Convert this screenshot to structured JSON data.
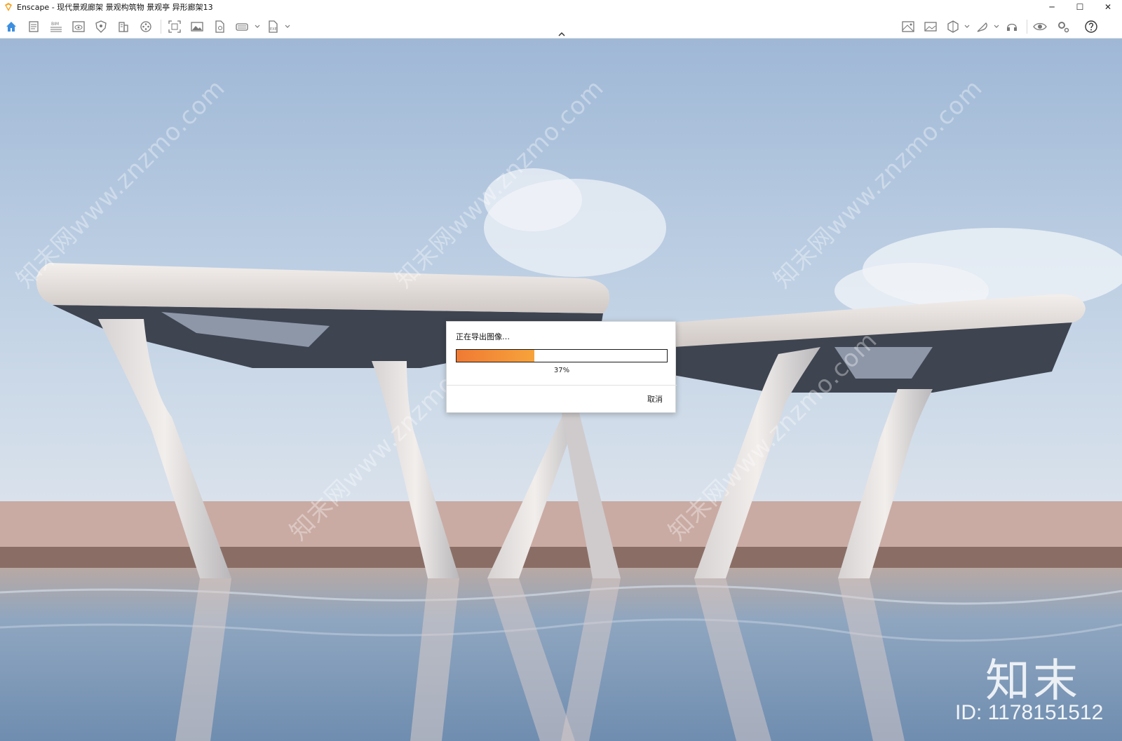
{
  "window": {
    "title": "Enscape - 现代景观廊架 景观构筑物 景观亭 异形廊架13",
    "controls": {
      "minimize": "─",
      "maximize": "☐",
      "close": "✕"
    }
  },
  "toolbar": {
    "left_icons": [
      "home-icon",
      "document-icon",
      "bim-icon",
      "eye-box-icon",
      "shield-icon",
      "building-icon",
      "film-reel-icon",
      "screenshot-icon",
      "image-icon",
      "file-export-icon",
      "vr-headset-icon",
      "exe-export-icon"
    ],
    "right_icons": [
      "asset-library-icon",
      "image-settings-icon",
      "cube-view-icon",
      "feather-icon",
      "headset-icon",
      "visibility-icon",
      "settings-icon",
      "help-icon"
    ],
    "bim_label": "BIM",
    "exe_label": "EXE"
  },
  "dialog": {
    "title": "正在导出图像…",
    "progress": 0.37,
    "progress_text": "37%",
    "cancel_label": "取消"
  },
  "watermark": {
    "text": "知末网www.znzmo.com",
    "brand": "知末",
    "id_text": "ID: 1178151512"
  },
  "colors": {
    "accent": "#4a90d9",
    "progress_start": "#f07a34",
    "progress_end": "#f7a33b"
  }
}
